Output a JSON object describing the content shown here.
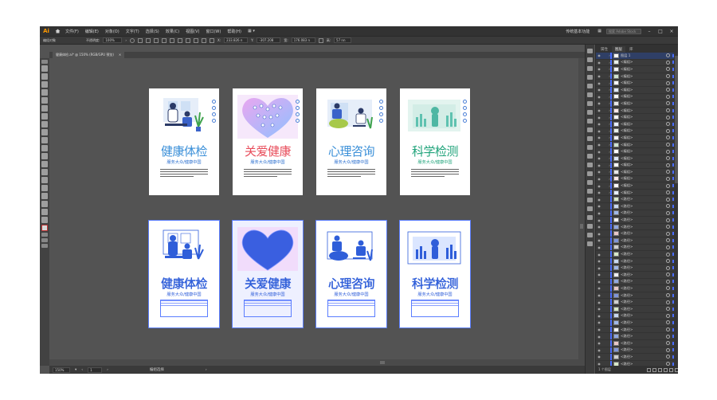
{
  "app": {
    "logo": "Ai",
    "home_icon": "home-icon"
  },
  "menu": [
    "文件(F)",
    "编辑(E)",
    "对象(O)",
    "文字(T)",
    "选择(S)",
    "效果(C)",
    "视图(V)",
    "窗口(W)",
    "帮助(H)"
  ],
  "menu_right": {
    "workspace": "传统基本功能",
    "search_placeholder": "搜索 Adobe Stock"
  },
  "controlbar": {
    "selection_label": "编组对象",
    "opacity_label": "不透明度:",
    "opacity_value": "100%",
    "x_label": "X:",
    "x_value": "233.826 n",
    "y_label": "Y:",
    "y_value": "-307.208",
    "w_label": "宽:",
    "w_value": "176.083 n",
    "h_label": "高:",
    "h_value": "57 nn"
  },
  "document_tab": {
    "title": "健康体检.ai* @ 150% (RGB/GPU 预览)",
    "close": "×"
  },
  "posters_top": [
    {
      "title": "健康体检",
      "color": "#3a8fd8",
      "subtitle": "服务大众/健康中国"
    },
    {
      "title": "关爱健康",
      "color": "#e84d5b",
      "subtitle": "服务大众/健康中国"
    },
    {
      "title": "心理咨询",
      "color": "#3a8fd8",
      "subtitle": "服务大众/健康中国"
    },
    {
      "title": "科学检测",
      "color": "#1fa37a",
      "subtitle": "服务大众/健康中国"
    }
  ],
  "posters_bottom": [
    {
      "title": "健康体检",
      "subtitle": "服务大众/健康中国"
    },
    {
      "title": "关爱健康",
      "subtitle": "服务大众/健康中国"
    },
    {
      "title": "心理咨询",
      "subtitle": "服务大众/健康中国"
    },
    {
      "title": "科学检测",
      "subtitle": "服务大众/健康中国"
    }
  ],
  "statusbar": {
    "zoom": "150%",
    "page": "1",
    "tool_label": "编组选择"
  },
  "layers_panel": {
    "tabs": [
      "属性",
      "图层",
      "库"
    ],
    "top_layer": "图层 1",
    "group_label": "<编组>",
    "path_label": "<路径>",
    "group_count": 20,
    "path_count": 25,
    "footer_count": "1 个图层"
  }
}
